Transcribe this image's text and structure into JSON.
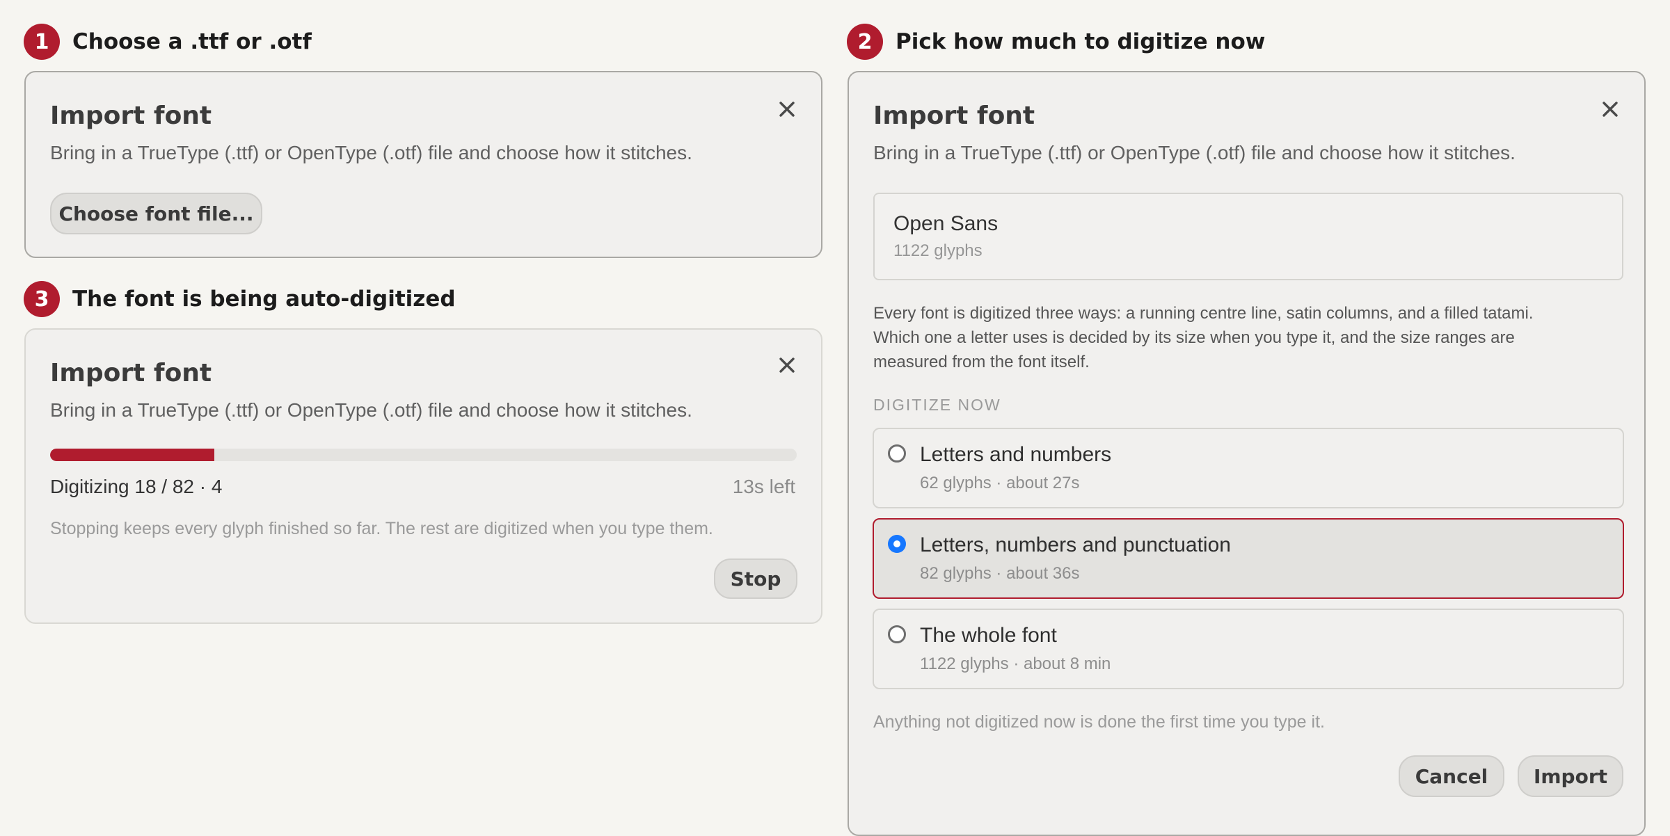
{
  "steps": [
    {
      "number": "1",
      "title": "Choose a .ttf or .otf"
    },
    {
      "number": "2",
      "title": "Pick how much to digitize now"
    },
    {
      "number": "3",
      "title": "The font is being auto-digitized"
    }
  ],
  "dialog": {
    "title": "Import font",
    "subtitle": "Bring in a TrueType (.ttf) or OpenType (.otf) file and choose how it stitches."
  },
  "panel1": {
    "choose_button": "Choose font file..."
  },
  "panel3": {
    "progress_fraction": 0.22,
    "status": "Digitizing 18 / 82 · 4",
    "time_left": "13s left",
    "note": "Stopping keeps every glyph finished so far. The rest are digitized when you type them.",
    "stop_button": "Stop"
  },
  "panel2": {
    "font_name": "Open Sans",
    "font_glyphs": "1122 glyphs",
    "description": [
      "Every font is digitized three ways: a running centre line, satin columns, and a filled tatami.",
      "Which one a letter uses is decided by its size when you type it, and the size ranges are",
      "measured from the font itself."
    ],
    "section_label": "DIGITIZE NOW",
    "options": [
      {
        "label": "Letters and numbers",
        "meta": "62 glyphs · about 27s",
        "selected": false
      },
      {
        "label": "Letters, numbers and punctuation",
        "meta": "82 glyphs · about 36s",
        "selected": true
      },
      {
        "label": "The whole font",
        "meta": "1122 glyphs · about 8 min",
        "selected": false
      }
    ],
    "footnote": "Anything not digitized now is done the first time you type it.",
    "cancel_button": "Cancel",
    "import_button": "Import"
  },
  "colors": {
    "accent": "#b01c2e",
    "radio_selected": "#1677ff",
    "background": "#f6f5f1",
    "panel": "#f1f0ee"
  },
  "icons": {
    "close": "close-icon",
    "radio": "radio-button"
  }
}
